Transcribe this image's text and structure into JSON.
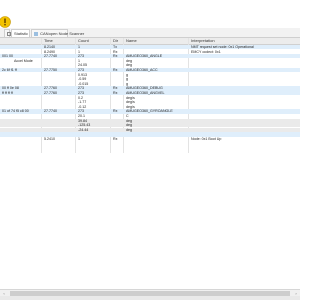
{
  "tabs": [
    {
      "label": "Statistic",
      "active": true
    },
    {
      "label": "CANopen Node Scanner",
      "active": false
    }
  ],
  "columns": {
    "c0": "",
    "time": "Time",
    "count": "Count",
    "dir": "Dir",
    "name": "Name",
    "interp": "Interpretation"
  },
  "rows": [
    {
      "c0": "",
      "time": "8.2140",
      "count": "1",
      "dir": "Tx",
      "name": "",
      "interp": "NMT request set node: 0x1 Operational",
      "style": "hl"
    },
    {
      "c0": "",
      "time": "8.2490",
      "count": "1",
      "dir": "Rx",
      "name": "",
      "interp": "EMCY ocdect: 0x1",
      "style": ""
    },
    {
      "c0": "001 00",
      "time": "27.7740",
      "count": "273",
      "dir": "Rx",
      "name": "AMUGEO360_ANGLE",
      "interp": "",
      "style": "hl"
    },
    {
      "c0": "Accel Mode",
      "time": "",
      "count": "1",
      "dir": "",
      "name": "deg",
      "interp": "",
      "style": "indent"
    },
    {
      "c0": "",
      "time": "",
      "count": "24.05",
      "dir": "",
      "name": "deg",
      "interp": "",
      "style": ""
    },
    {
      "c0": "2c 6f f1 ff",
      "time": "27.7750",
      "count": "273",
      "dir": "Rx",
      "name": "AMUGEO360_ACC",
      "interp": "",
      "style": "hl"
    },
    {
      "c0": "",
      "time": "",
      "count": "0.913",
      "dir": "",
      "name": "g",
      "interp": "",
      "style": ""
    },
    {
      "c0": "",
      "time": "",
      "count": "-0.59",
      "dir": "",
      "name": "g",
      "interp": "",
      "style": ""
    },
    {
      "c0": "",
      "time": "",
      "count": "-0.015",
      "dir": "",
      "name": "g",
      "interp": "",
      "style": ""
    },
    {
      "c0": "00 ff 0e 08",
      "time": "27.7760",
      "count": "273",
      "dir": "Rx",
      "name": "AMUGEO360_DEBUG",
      "interp": "",
      "style": "hl"
    },
    {
      "c0": "ff ff ff ff",
      "time": "27.7760",
      "count": "273",
      "dir": "Rx",
      "name": "AMUGEO360_ANGVEL",
      "interp": "",
      "style": "hl"
    },
    {
      "c0": "",
      "time": "",
      "count": "0.2",
      "dir": "",
      "name": "deg/s",
      "interp": "",
      "style": ""
    },
    {
      "c0": "",
      "time": "",
      "count": "-1.77",
      "dir": "",
      "name": "deg/s",
      "interp": "",
      "style": ""
    },
    {
      "c0": "",
      "time": "",
      "count": "-0.12",
      "dir": "",
      "name": "deg/s",
      "interp": "",
      "style": ""
    },
    {
      "c0": "01 of 74 f5 c8 00",
      "time": "27.7740",
      "count": "273",
      "dir": "Rx",
      "name": "AMUGEO360_GYROANGLE",
      "interp": "",
      "style": "hl"
    },
    {
      "c0": "",
      "time": "",
      "count": "20.1",
      "dir": "",
      "name": "C",
      "interp": "",
      "style": ""
    },
    {
      "c0": "",
      "time": "",
      "count": "39.84",
      "dir": "",
      "name": "deg",
      "interp": "",
      "style": "gray"
    },
    {
      "c0": "",
      "time": "",
      "count": "-125.43",
      "dir": "",
      "name": "deg",
      "interp": "",
      "style": "gray"
    },
    {
      "c0": "",
      "time": "",
      "count": "-24.44",
      "dir": "",
      "name": "deg",
      "interp": "",
      "style": "gray"
    },
    {
      "c0": "",
      "time": "",
      "count": "",
      "dir": "",
      "name": "",
      "interp": "",
      "style": "hl"
    },
    {
      "c0": "",
      "time": "5.2410",
      "count": "1",
      "dir": "Rx",
      "name": "",
      "interp": "Node: 0x1 Boot Up",
      "style": ""
    }
  ],
  "colors": {
    "highlight": "#dfeefb",
    "warn": "#f2c200"
  },
  "icons": {
    "warning": "warning-icon"
  }
}
